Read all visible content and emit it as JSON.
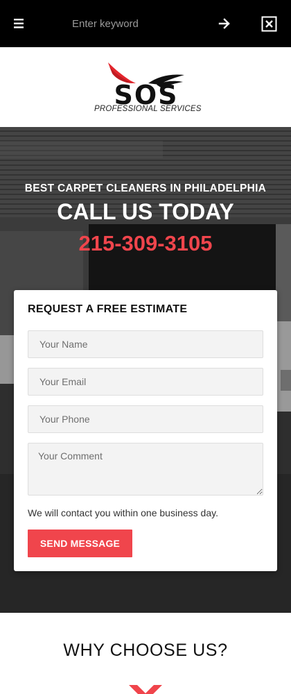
{
  "top_bar": {
    "search_placeholder": "Enter keyword",
    "menu_icon": "hamburger-menu-icon",
    "go_icon": "arrow-right-icon",
    "close_icon": "close-box-icon"
  },
  "logo": {
    "wordmark": "SOS",
    "tagline": "PROFESSIONAL SERVICES"
  },
  "hero": {
    "subtitle": "BEST CARPET CLEANERS IN PHILADELPHIA",
    "title": "CALL US TODAY",
    "phone": "215-309-3105"
  },
  "form": {
    "title": "REQUEST A FREE ESTIMATE",
    "name_placeholder": "Your Name",
    "email_placeholder": "Your Email",
    "phone_placeholder": "Your Phone",
    "comment_placeholder": "Your Comment",
    "note": "We will contact you within one business day.",
    "submit_label": "SEND MESSAGE"
  },
  "why": {
    "title": "WHY CHOOSE US?"
  },
  "colors": {
    "accent": "#f0454c",
    "top_bar_bg": "#000000",
    "logo_red": "#e4262d"
  }
}
